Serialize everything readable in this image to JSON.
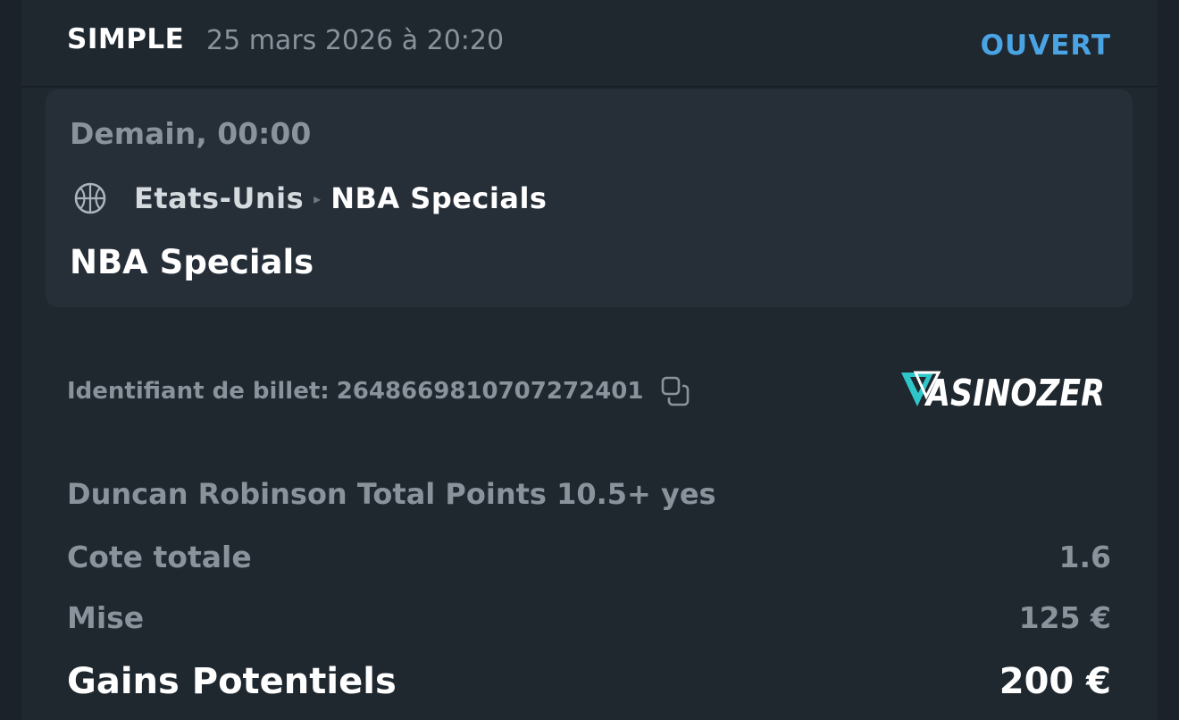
{
  "colors": {
    "background": "#1b222a",
    "card": "#1f272f",
    "event_box": "#262e38",
    "status": "#4aa3e3",
    "muted": "#8a939c",
    "text": "#ffffff"
  },
  "header": {
    "bet_type": "SIMPLE",
    "date": "25 mars 2026 à 20:20",
    "status": "OUVERT"
  },
  "event": {
    "time": "Demain, 00:00",
    "sport_icon": "basketball-icon",
    "country": "Etats-Unis",
    "separator_icon": "chevron-right-icon",
    "league": "NBA Specials",
    "name": "NBA Specials"
  },
  "ticket": {
    "label": "Identifiant de billet:",
    "id": "2648669810707272401",
    "copy_icon": "copy-icon"
  },
  "brand": {
    "logo_text": "CASINOZER"
  },
  "bet": {
    "selection": "Duncan Robinson Total Points 10.5+ yes",
    "odds_label": "Cote totale",
    "odds_value": "1.6",
    "stake_label": "Mise",
    "stake_value": "125 €",
    "payout_label": "Gains Potentiels",
    "payout_value": "200 €"
  }
}
